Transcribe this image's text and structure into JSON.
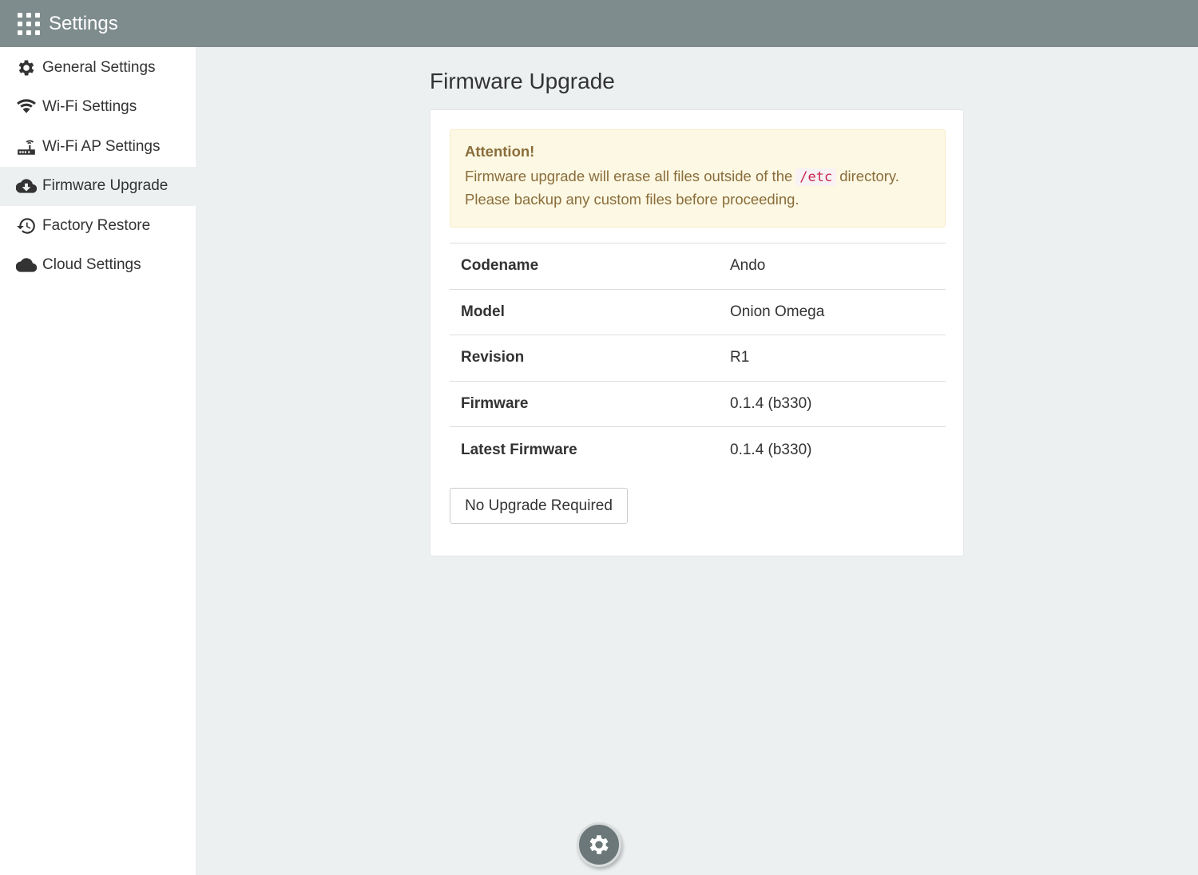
{
  "header": {
    "title": "Settings",
    "menu_icon": "grid-icon",
    "background": "#7f8c8d"
  },
  "sidebar": {
    "items": [
      {
        "label": "General Settings",
        "icon": "gear-icon",
        "active": false
      },
      {
        "label": "Wi-Fi Settings",
        "icon": "wifi-icon",
        "active": false
      },
      {
        "label": "Wi-Fi AP Settings",
        "icon": "router-icon",
        "active": false
      },
      {
        "label": "Firmware Upgrade",
        "icon": "cloud-download-icon",
        "active": true
      },
      {
        "label": "Factory Restore",
        "icon": "history-icon",
        "active": false
      },
      {
        "label": "Cloud Settings",
        "icon": "cloud-icon",
        "active": false
      }
    ]
  },
  "main": {
    "title": "Firmware Upgrade",
    "alert": {
      "title": "Attention!",
      "text_before": "Firmware upgrade will erase all files outside of the",
      "code": "/etc",
      "text_after": "directory.",
      "line2": "Please backup any custom files before proceeding.",
      "color": "#8a6d3b",
      "background": "#fcf8e3"
    },
    "info": [
      {
        "key": "Codename",
        "value": "Ando"
      },
      {
        "key": "Model",
        "value": "Onion Omega"
      },
      {
        "key": "Revision",
        "value": "R1"
      },
      {
        "key": "Firmware",
        "value": "0.1.4 (b330)"
      },
      {
        "key": "Latest Firmware",
        "value": "0.1.4 (b330)"
      }
    ],
    "button_label": "No Upgrade Required"
  },
  "fab": {
    "icon": "gear-icon"
  }
}
